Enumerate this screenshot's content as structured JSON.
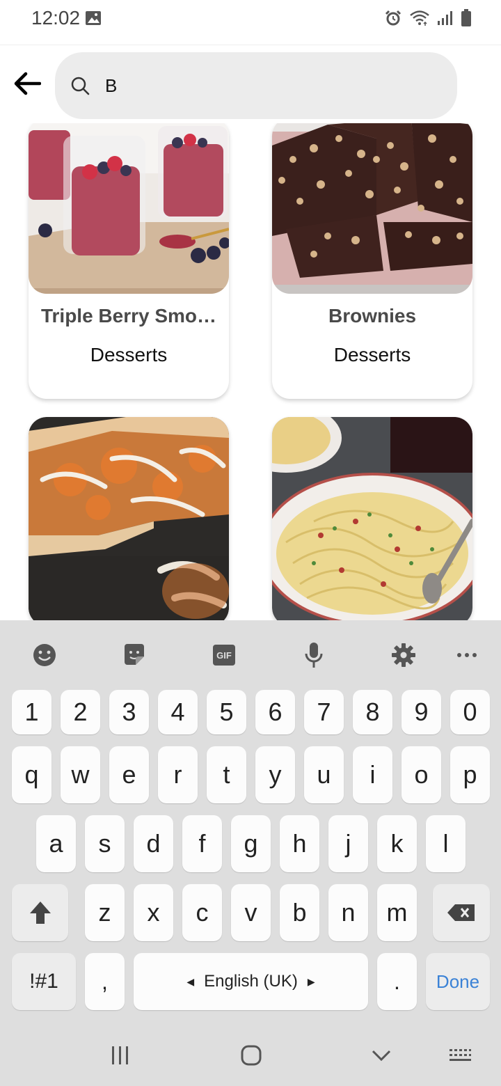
{
  "status_bar": {
    "time": "12:02"
  },
  "search": {
    "value": "B"
  },
  "results": [
    {
      "title": "Triple Berry Smo…",
      "category": "Desserts"
    },
    {
      "title": "Brownies",
      "category": "Desserts"
    },
    {
      "title": "",
      "category": ""
    },
    {
      "title": "",
      "category": ""
    }
  ],
  "keyboard": {
    "row_numbers": [
      "1",
      "2",
      "3",
      "4",
      "5",
      "6",
      "7",
      "8",
      "9",
      "0"
    ],
    "row_1": [
      "q",
      "w",
      "e",
      "r",
      "t",
      "y",
      "u",
      "i",
      "o",
      "p"
    ],
    "row_2": [
      "a",
      "s",
      "d",
      "f",
      "g",
      "h",
      "j",
      "k",
      "l"
    ],
    "row_3": [
      "z",
      "x",
      "c",
      "v",
      "b",
      "n",
      "m"
    ],
    "symbols_label": "!#1",
    "comma_label": ",",
    "space_label": "English (UK)",
    "period_label": ".",
    "done_label": "Done",
    "gif_label": "GIF"
  },
  "colors": {
    "done": "#3b82d6",
    "keyboard_bg": "#dedede",
    "search_bg": "#ececec"
  }
}
